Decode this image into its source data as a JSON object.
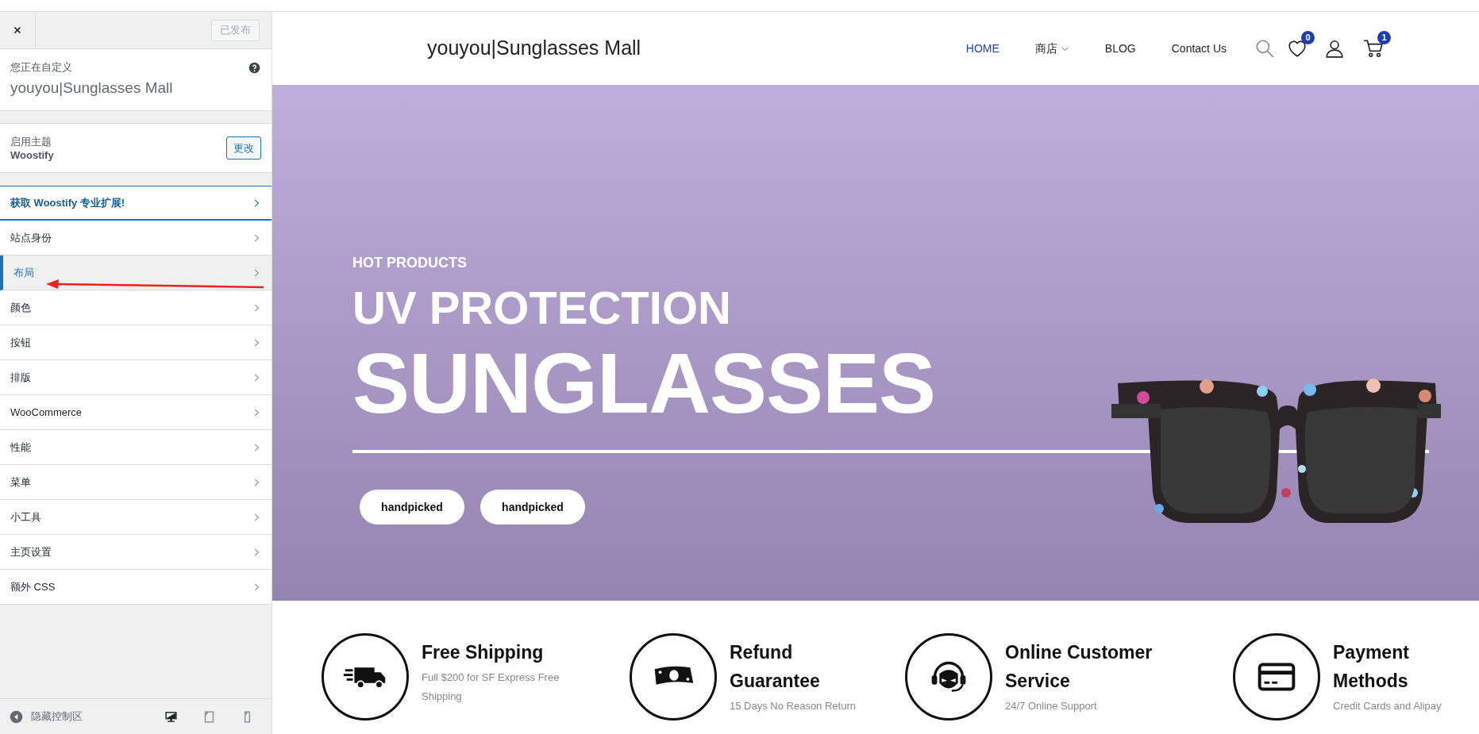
{
  "customizer": {
    "publish_button": {
      "label": "已发布",
      "disabled": true
    },
    "info": {
      "label": "您正在自定义",
      "site_title": "youyou|Sunglasses Mall"
    },
    "theme": {
      "label": "启用主题",
      "name": "Woostify",
      "button": "更改"
    },
    "sections": [
      {
        "label": "获取 Woostify 专业扩展!",
        "kind": "promo",
        "selected": false
      },
      {
        "label": "站点身份",
        "kind": "section",
        "selected": false
      },
      {
        "label": "布局",
        "kind": "section",
        "selected": true
      },
      {
        "label": "颜色",
        "kind": "section",
        "selected": false
      },
      {
        "label": "按钮",
        "kind": "section",
        "selected": false
      },
      {
        "label": "排版",
        "kind": "section",
        "selected": false
      },
      {
        "label": "WooCommerce",
        "kind": "section",
        "selected": false
      },
      {
        "label": "性能",
        "kind": "section",
        "selected": false
      },
      {
        "label": "菜单",
        "kind": "section",
        "selected": false
      },
      {
        "label": "小工具",
        "kind": "section",
        "selected": false
      },
      {
        "label": "主页设置",
        "kind": "section",
        "selected": false
      },
      {
        "label": "额外 CSS",
        "kind": "section",
        "selected": false
      }
    ],
    "footer": {
      "collapse_label": "隐藏控制区",
      "devices": [
        {
          "kind": "desktop",
          "selected": true
        },
        {
          "kind": "tablet",
          "selected": false
        },
        {
          "kind": "mobile",
          "selected": false
        }
      ]
    }
  },
  "preview": {
    "header": {
      "logo": "youyou|Sunglasses Mall",
      "nav": [
        {
          "label": "HOME",
          "selected": true,
          "dropdown": false
        },
        {
          "label": "商店",
          "selected": false,
          "dropdown": true
        },
        {
          "label": "BLOG",
          "selected": false,
          "dropdown": false
        },
        {
          "label": "Contact Us",
          "selected": false,
          "dropdown": false
        }
      ],
      "wishlist_count": "0",
      "cart_count": "1"
    },
    "hero": {
      "eyebrow": "HOT PRODUCTS",
      "title": "UV PROTECTION",
      "headline": "SUNGLASSES",
      "buttons": [
        "handpicked",
        "handpicked"
      ]
    },
    "features": [
      {
        "kind": "truck",
        "title": "Free Shipping",
        "text": "Full $200 for SF Express Free Shipping"
      },
      {
        "kind": "cash",
        "title": "Refund Guarantee",
        "text": "15 Days No Reason Return"
      },
      {
        "kind": "headset",
        "title": "Online Customer Service",
        "text": "24/7 Online Support"
      },
      {
        "kind": "card",
        "title": "Payment Methods",
        "text": "Credit Cards and Alipay"
      }
    ]
  }
}
